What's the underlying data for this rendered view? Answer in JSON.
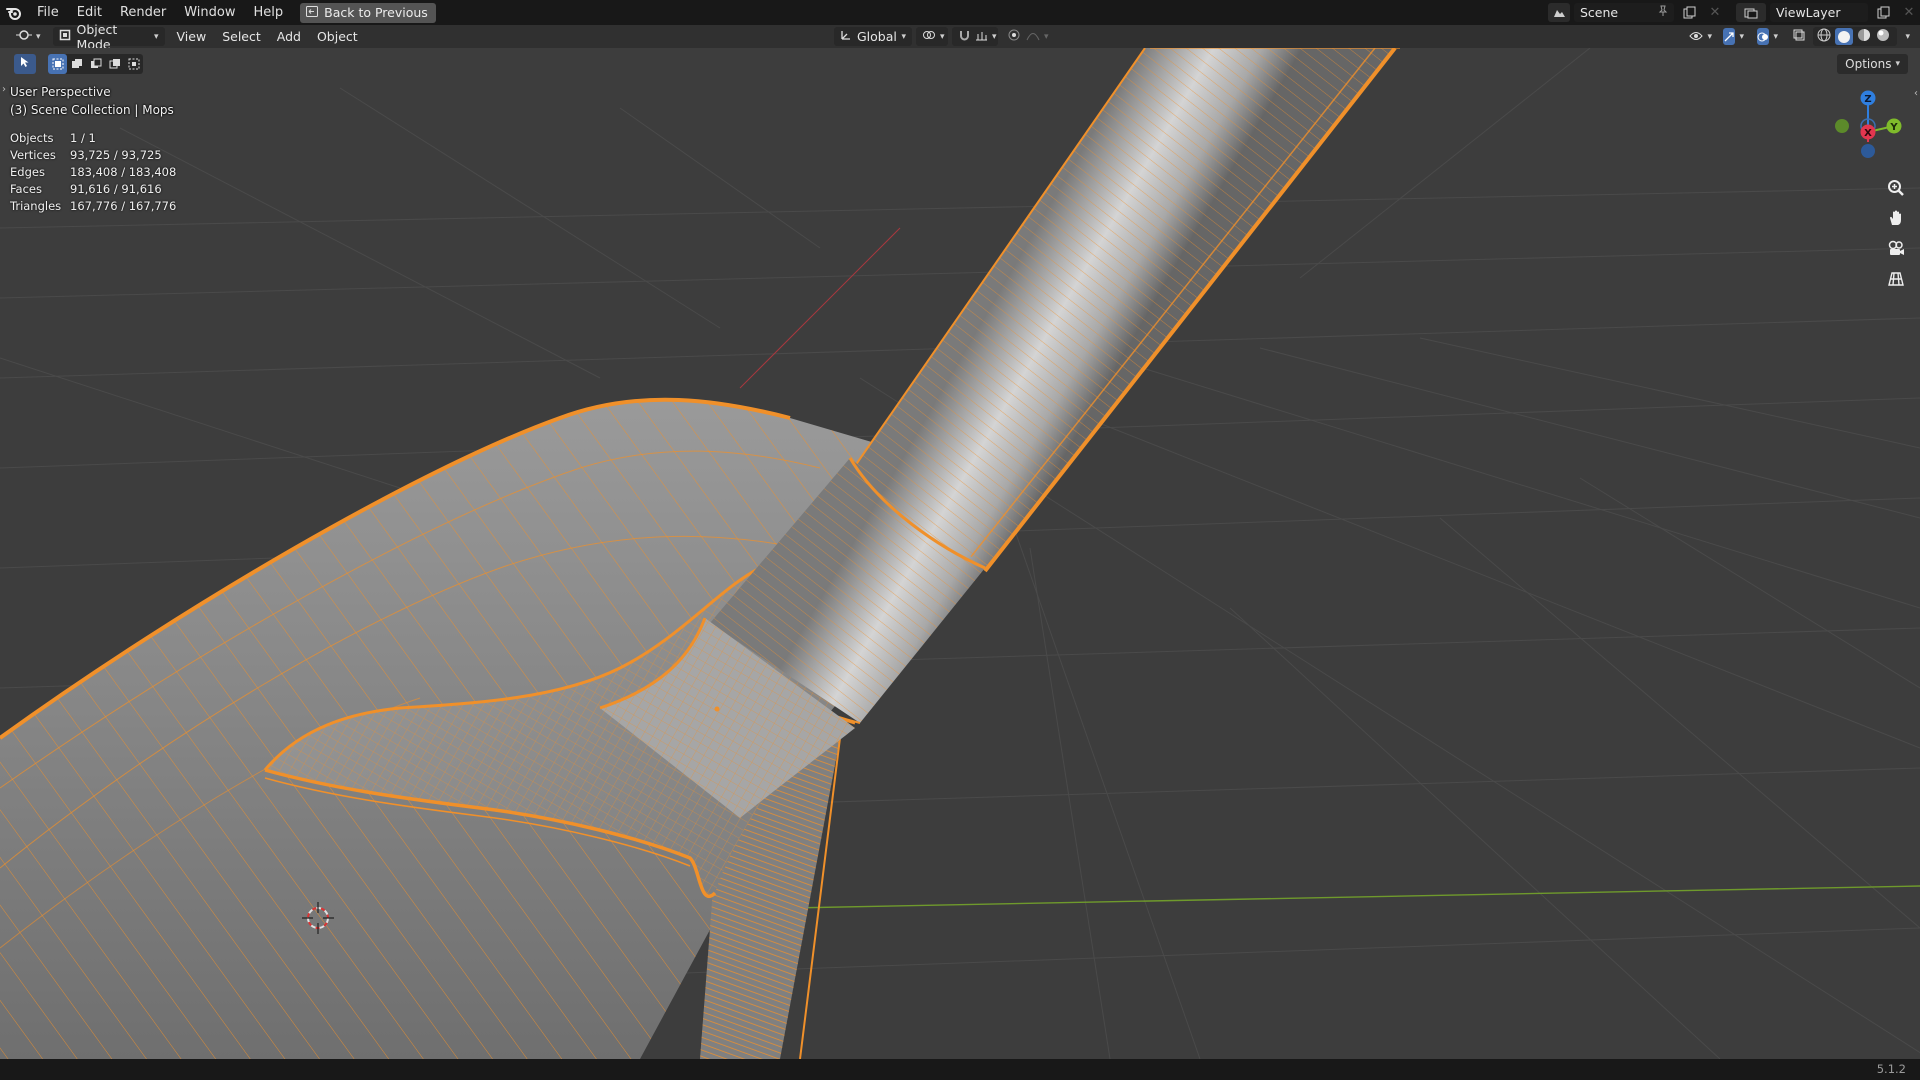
{
  "menu": {
    "items": [
      "File",
      "Edit",
      "Render",
      "Window",
      "Help"
    ],
    "back_button": "Back to Previous"
  },
  "scene": {
    "label": "Scene",
    "view_layer": "ViewLayer"
  },
  "header": {
    "mode": "Object Mode",
    "menus": [
      "View",
      "Select",
      "Add",
      "Object"
    ],
    "transform_orientation": "Global",
    "options_label": "Options"
  },
  "viewport": {
    "perspective_label": "User Perspective",
    "collection_label": "(3) Scene Collection | Mops",
    "stats": [
      {
        "label": "Objects",
        "value": "1 / 1"
      },
      {
        "label": "Vertices",
        "value": "93,725 / 93,725"
      },
      {
        "label": "Edges",
        "value": "183,408 / 183,408"
      },
      {
        "label": "Faces",
        "value": "91,616 / 91,616"
      },
      {
        "label": "Triangles",
        "value": "167,776 / 167,776"
      }
    ],
    "gizmo": {
      "z": "Z",
      "x": "X",
      "y": "Y"
    }
  },
  "status": {
    "version": "5.1.2"
  },
  "colors": {
    "selection": "#f0902a",
    "axis_x": "#e2364f",
    "axis_y": "#7fbb2b",
    "axis_z": "#2f7fe0",
    "active_blue": "#4772b3"
  }
}
